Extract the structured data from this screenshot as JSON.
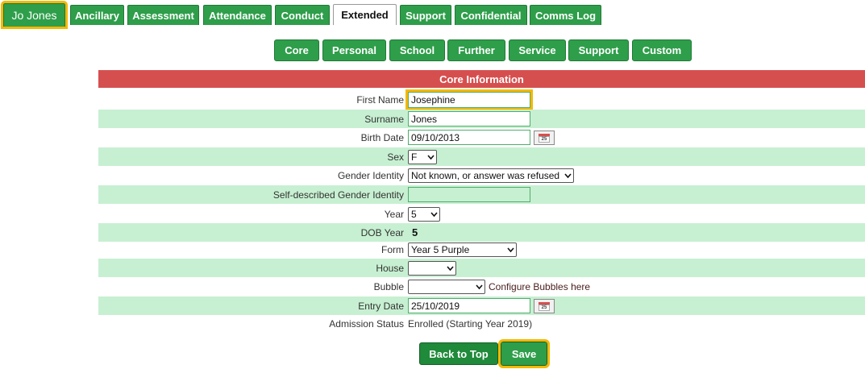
{
  "top_tabs": [
    {
      "label": "Jo Jones"
    },
    {
      "label": "Ancillary"
    },
    {
      "label": "Assessment"
    },
    {
      "label": "Attendance"
    },
    {
      "label": "Conduct"
    },
    {
      "label": "Extended"
    },
    {
      "label": "Support"
    },
    {
      "label": "Confidential"
    },
    {
      "label": "Comms Log"
    }
  ],
  "sub_tabs": [
    {
      "label": "Core"
    },
    {
      "label": "Personal"
    },
    {
      "label": "School"
    },
    {
      "label": "Further"
    },
    {
      "label": "Service"
    },
    {
      "label": "Support"
    },
    {
      "label": "Custom"
    }
  ],
  "section": {
    "title": "Core Information"
  },
  "form": {
    "first_name": {
      "label": "First Name",
      "value": "Josephine"
    },
    "surname": {
      "label": "Surname",
      "value": "Jones"
    },
    "birth_date": {
      "label": "Birth Date",
      "value": "09/10/2013",
      "calendar_day": "25"
    },
    "sex": {
      "label": "Sex",
      "value": "F"
    },
    "gender_identity": {
      "label": "Gender Identity",
      "value": "Not known, or answer was refused"
    },
    "self_described": {
      "label": "Self-described Gender Identity",
      "value": ""
    },
    "year": {
      "label": "Year",
      "value": "5"
    },
    "dob_year": {
      "label": "DOB Year",
      "value": "5"
    },
    "form_group": {
      "label": "Form",
      "value": "Year 5 Purple"
    },
    "house": {
      "label": "House",
      "value": ""
    },
    "bubble": {
      "label": "Bubble",
      "value": "",
      "link": "Configure Bubbles here"
    },
    "entry_date": {
      "label": "Entry Date",
      "value": "25/10/2019",
      "calendar_day": "25"
    },
    "admission_status": {
      "label": "Admission Status",
      "value": "Enrolled (Starting Year 2019)"
    }
  },
  "buttons": {
    "back_to_top": "Back to Top",
    "save": "Save"
  },
  "colors": {
    "green": "#2e9e4a",
    "header_red": "#d64f4f",
    "row_green": "#c7f0d2",
    "highlight": "#f5b800"
  }
}
